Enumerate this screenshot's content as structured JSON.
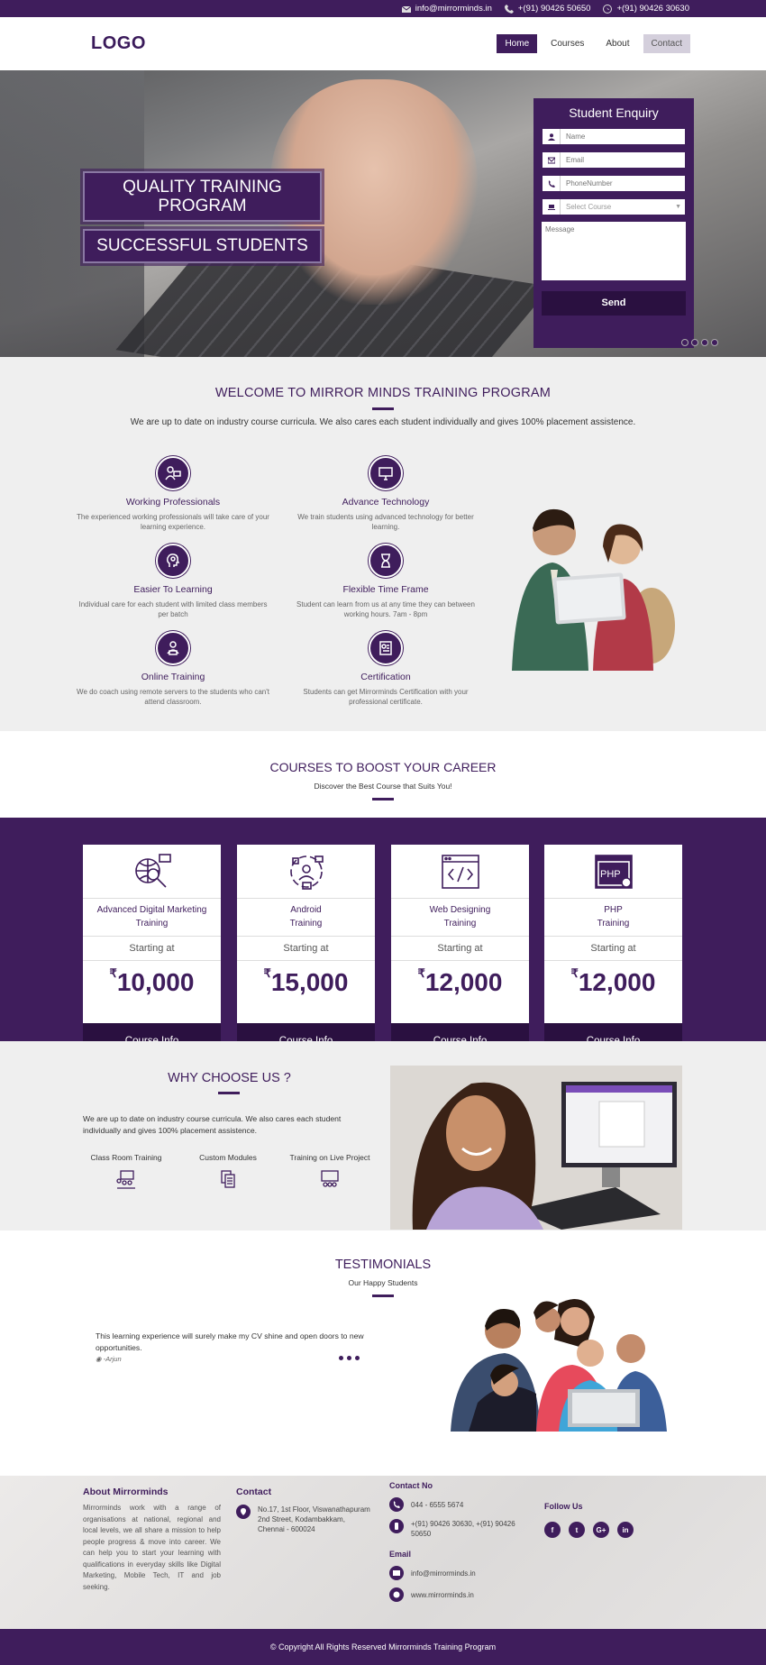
{
  "topbar": {
    "email": "info@mirrorminds.in",
    "phone": "+(91) 90426 50650",
    "whatsapp": "+(91) 90426 30630"
  },
  "header": {
    "logo": "LOGO",
    "nav": [
      "Home",
      "Courses",
      "About",
      "Contact"
    ],
    "active": "Home"
  },
  "hero": {
    "banner1": "QUALITY TRAINING PROGRAM",
    "banner2": "SUCCESSFUL STUDENTS",
    "slider_dots": 4,
    "enquiry": {
      "title": "Student Enquiry",
      "name_placeholder": "Name",
      "email_placeholder": "Email",
      "phone_placeholder": "PhoneNumber",
      "course_select": "Select Course",
      "message_placeholder": "Message",
      "send": "Send"
    }
  },
  "welcome": {
    "title": "WELCOME TO MIRROR MINDS TRAINING PROGRAM",
    "subtitle": "We are up to date on industry course curricula. We also cares each student individually and gives 100% placement assistence.",
    "features": [
      {
        "title": "Working Professionals",
        "text": "The experienced working professionals will take care of your learning experience."
      },
      {
        "title": "Advance Technology",
        "text": "We train students using advanced technology for better learning."
      },
      {
        "title": "Easier To Learning",
        "text": "Individual care for each student with limited class members per batch"
      },
      {
        "title": "Flexible Time Frame",
        "text": "Student can learn from us at any time they can between working hours. 7am - 8pm"
      },
      {
        "title": "Online Training",
        "text": "We do coach using remote servers to the students who can't attend classroom."
      },
      {
        "title": "Certification",
        "text": "Students can get Mirrorminds Certification with your professional certificate."
      }
    ]
  },
  "courses": {
    "title": "COURSES TO BOOST YOUR CAREER",
    "subtitle": "Discover the Best Course that Suits You!",
    "starting_label": "Starting at",
    "currency": "₹",
    "button": "Course Info",
    "items": [
      {
        "line1": "Advanced Digital Marketing",
        "line2": "Training",
        "price": "10,000",
        "icon": "digital-marketing-icon"
      },
      {
        "line1": "Android",
        "line2": "Training",
        "price": "15,000",
        "icon": "android-icon"
      },
      {
        "line1": "Web Designing",
        "line2": "Training",
        "price": "12,000",
        "icon": "web-design-icon"
      },
      {
        "line1": "PHP",
        "line2": "Training",
        "price": "12,000",
        "icon": "php-icon"
      }
    ]
  },
  "why": {
    "title": "WHY CHOOSE US ?",
    "text": "We are up to date on industry course curricula. We also cares each student individually and gives 100% placement assistence.",
    "options": [
      "Class Room Training",
      "Custom Modules",
      "Training on Live Project"
    ]
  },
  "testimonials": {
    "title": "TESTIMONIALS",
    "subtitle": "Our Happy Students",
    "quote": "This learning experience will surely make my CV shine and open doors to new opportunities.",
    "author": "-Arjun"
  },
  "footer": {
    "about_title": "About Mirrorminds",
    "about_text": "Mirrorminds work with a range of organisations at national, regional and local levels, we all share a mission to help people progress & move into career. We can help you to start your learning with qualifications in everyday skills like Digital Marketing, Mobile Tech, IT and job seeking.",
    "contact_title": "Contact",
    "address": "No.17, 1st Floor, Viswanathapuram 2nd Street, Kodambakkam, Chennai - 600024",
    "contact_no_title": "Contact No",
    "landline": "044 - 6555 5674",
    "mobile": "+(91) 90426 30630, +(91) 90426 50650",
    "email_title": "Email",
    "email": "info@mirrorminds.in",
    "website": "www.mirrorminds.in",
    "follow_title": "Follow Us",
    "social": [
      "f",
      "t",
      "G+",
      "in"
    ],
    "copyright": "© Copyright All Rights Reserved Mirrorminds Training Program"
  },
  "colors": {
    "brand": "#3f1d5c",
    "brand_dark": "#2a1040"
  }
}
